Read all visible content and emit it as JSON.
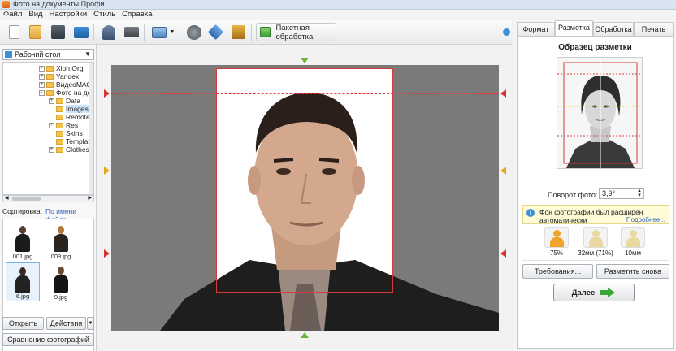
{
  "window": {
    "title": "Фото на документы Профи"
  },
  "menu": [
    "Файл",
    "Вид",
    "Настройки",
    "Стиль",
    "Справка"
  ],
  "toolbar": {
    "batch_label": "Пакетная обработка"
  },
  "left": {
    "folder": "Рабочий стол",
    "tree": [
      {
        "label": "Xiph.Org",
        "indent": 1,
        "expander": "+"
      },
      {
        "label": "Yandex",
        "indent": 1,
        "expander": "+"
      },
      {
        "label": "ВидеоМАСТ",
        "indent": 1,
        "expander": "+"
      },
      {
        "label": "Фото на док",
        "indent": 1,
        "expander": "-"
      },
      {
        "label": "Data",
        "indent": 2,
        "expander": "+"
      },
      {
        "label": "Images",
        "indent": 2,
        "expander": "",
        "selected": true
      },
      {
        "label": "Remote",
        "indent": 2,
        "expander": ""
      },
      {
        "label": "Res",
        "indent": 2,
        "expander": "+"
      },
      {
        "label": "Skins",
        "indent": 2,
        "expander": ""
      },
      {
        "label": "Template",
        "indent": 2,
        "expander": ""
      },
      {
        "label": "Clothes",
        "indent": 2,
        "expander": "+"
      }
    ],
    "sort_label": "Сортировка:",
    "sort_value": "По имени файла",
    "thumbs": [
      {
        "name": "001.jpg"
      },
      {
        "name": "003.jpg"
      },
      {
        "name": "6.jpg",
        "selected": true
      },
      {
        "name": "9.jpg"
      }
    ],
    "open_label": "Открыть",
    "actions_label": "Действия",
    "compare_label": "Сравнение фотографий"
  },
  "right": {
    "tabs": [
      "Формат",
      "Разметка",
      "Обработка",
      "Печать"
    ],
    "active_tab": "Разметка",
    "sample_title": "Образец разметки",
    "rotation_label": "Поворот фото:",
    "rotation_value": "3,9°",
    "info_text": "Фон фотографии был расширен автоматически",
    "info_more": "Подробнее...",
    "stats": [
      "75%",
      "32мм (71%)",
      "10мм"
    ],
    "requirements_label": "Требования...",
    "remark_label": "Разметить снова",
    "next_label": "Далее"
  },
  "colors": {
    "accent": "#3d8fd8",
    "guide_red": "#e23b3b",
    "guide_yellow": "#e6cf2a",
    "next_arrow": "#3aa63a"
  }
}
